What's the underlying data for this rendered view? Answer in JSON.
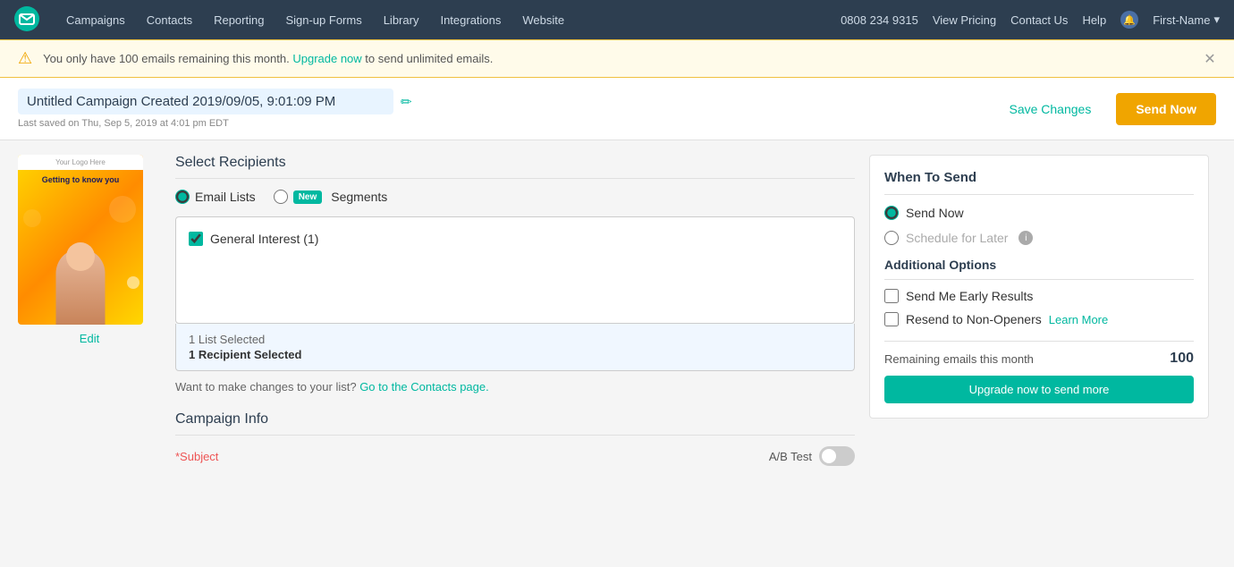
{
  "nav": {
    "logo_alt": "Sendlane logo",
    "links": [
      "Campaigns",
      "Contacts",
      "Reporting",
      "Sign-up Forms",
      "Library",
      "Integrations",
      "Website"
    ],
    "phone": "0808 234 9315",
    "view_pricing": "View Pricing",
    "contact_us": "Contact Us",
    "help": "Help",
    "user_name": "First-Name"
  },
  "alert": {
    "text_before": "You only have 100 emails remaining this month.",
    "upgrade_link": "Upgrade now",
    "text_after": "to send unlimited emails."
  },
  "header": {
    "campaign_title": "Untitled Campaign Created 2019/09/05, 9:01:09 PM",
    "last_saved": "Last saved on Thu, Sep 5, 2019 at 4:01 pm EDT",
    "save_changes_label": "Save Changes",
    "send_now_label": "Send Now"
  },
  "preview": {
    "logo_text": "Your Logo Here",
    "banner_text": "Getting to know you",
    "edit_label": "Edit"
  },
  "recipients": {
    "section_title": "Select Recipients",
    "option_email_lists": "Email Lists",
    "option_segments": "Segments",
    "new_badge": "New",
    "list_item_label": "General Interest (1)",
    "selection_count": "1 List Selected",
    "selection_recipient": "1 Recipient Selected",
    "contacts_link_text": "Want to make changes to your list?",
    "contacts_link": "Go to the Contacts page.",
    "selected_email_lists": true,
    "selected_segments": false,
    "list_checked": true
  },
  "campaign_info": {
    "section_title": "Campaign Info",
    "subject_label": "*Subject",
    "ab_test_label": "A/B Test"
  },
  "when_to_send": {
    "title": "When To Send",
    "send_now_label": "Send Now",
    "schedule_later_label": "Schedule for Later",
    "info_icon": "i",
    "send_now_selected": true,
    "additional_options_title": "Additional Options",
    "option_early_results": "Send Me Early Results",
    "option_resend": "Resend to Non-Openers",
    "learn_more_label": "Learn More",
    "remaining_label": "Remaining emails this month",
    "remaining_count": "100",
    "upgrade_btn_label": "Upgrade now to send more"
  }
}
